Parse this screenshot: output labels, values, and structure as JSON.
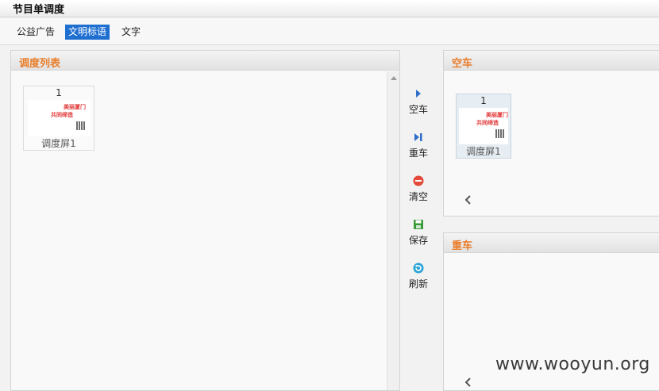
{
  "window": {
    "title": "节目单调度"
  },
  "tabs": [
    {
      "label": "公益广告",
      "active": false
    },
    {
      "label": "文明标语",
      "active": true
    },
    {
      "label": "文字",
      "active": false
    }
  ],
  "schedule_panel": {
    "title": "调度列表",
    "items": [
      {
        "number": "1",
        "label": "调度屏1",
        "preview_line1": "美丽厦门",
        "preview_line2": "共同缔造"
      }
    ]
  },
  "actions": [
    {
      "label": "空车",
      "icon": "play-right-icon"
    },
    {
      "label": "重车",
      "icon": "skip-next-icon"
    },
    {
      "label": "清空",
      "icon": "stop-circle-icon"
    },
    {
      "label": "保存",
      "icon": "save-disk-icon"
    },
    {
      "label": "刷新",
      "icon": "refresh-icon"
    }
  ],
  "empty_panel": {
    "title": "空车",
    "items": [
      {
        "number": "1",
        "label": "调度屏1",
        "preview_line1": "美丽厦门",
        "preview_line2": "共同缔造"
      }
    ]
  },
  "loaded_panel": {
    "title": "重车"
  },
  "watermark": "www.wooyun.org",
  "colors": {
    "accent": "#e87d2a",
    "active_tab": "#1f6fd1"
  }
}
